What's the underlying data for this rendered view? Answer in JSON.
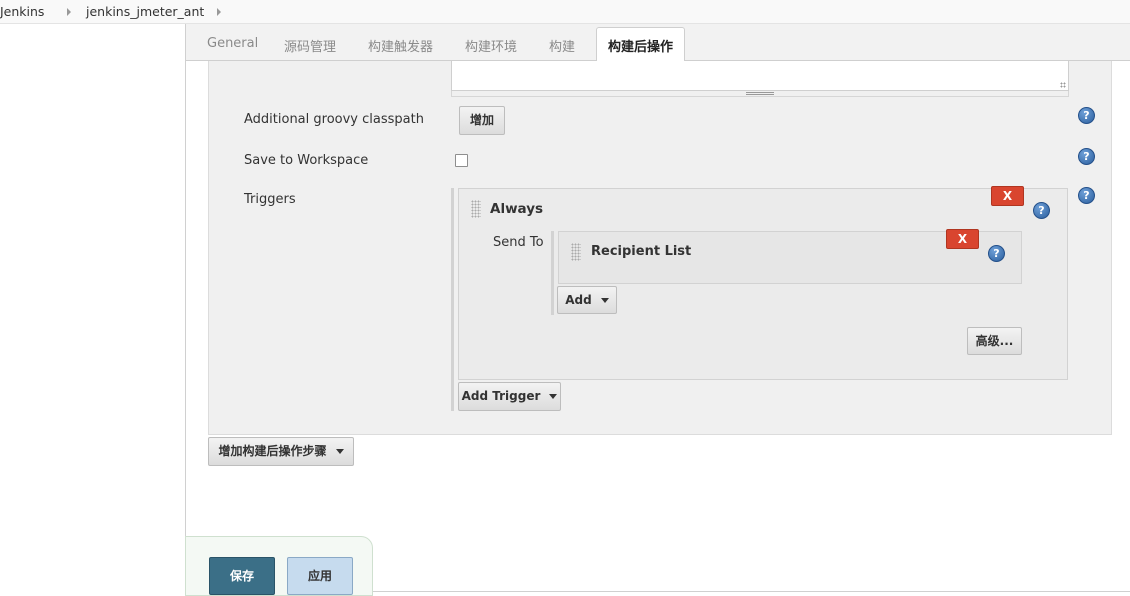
{
  "breadcrumb": {
    "items": [
      {
        "label": "Jenkins"
      },
      {
        "label": "jenkins_jmeter_ant"
      }
    ]
  },
  "tabs": [
    {
      "label": "General"
    },
    {
      "label": "源码管理"
    },
    {
      "label": "构建触发器"
    },
    {
      "label": "构建环境"
    },
    {
      "label": "构建"
    },
    {
      "label": "构建后操作"
    }
  ],
  "active_tab": "构建后操作",
  "fields": {
    "groovy_classpath": {
      "label": "Additional groovy classpath",
      "button": "增加"
    },
    "save_to_workspace": {
      "label": "Save to Workspace",
      "checked": false
    },
    "triggers": {
      "label": "Triggers"
    }
  },
  "trigger": {
    "title": "Always",
    "delete_label": "X",
    "send_to_label": "Send To",
    "recipient": {
      "title": "Recipient List",
      "delete_label": "X"
    },
    "add_button": "Add",
    "advanced_button": "高级..."
  },
  "add_trigger_button": "Add Trigger",
  "add_post_build_button": "增加构建后操作步骤",
  "help_glyph": "?",
  "actions": {
    "save": "保存",
    "apply": "应用"
  },
  "colors": {
    "delete_red": "#d9452f",
    "save_blue": "#3b6f87",
    "apply_light_blue": "#c6dbee",
    "help_blue": "#2b5f9e"
  },
  "icons": [
    "chevron-right-icon",
    "help-icon",
    "drag-handle-icon",
    "dropdown-caret-icon",
    "resize-grip-icon"
  ]
}
